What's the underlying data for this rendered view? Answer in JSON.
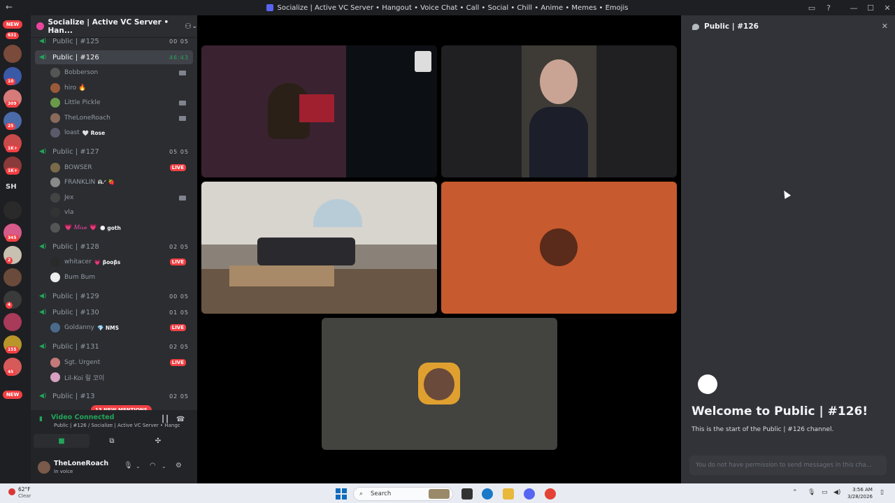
{
  "window": {
    "title": "Socialize | Active VC Server • Hangout • Voice Chat • Call • Social • Chill • Anime • Memes • Emojis"
  },
  "rail": {
    "new_label": "NEW",
    "badges": [
      "631",
      "10",
      "309",
      "25",
      "1K+",
      "1K+",
      "345",
      "2",
      "4",
      "155",
      "45"
    ],
    "sh_label": "SH"
  },
  "guild": {
    "name": "Socialize | Active VC Server • Han..."
  },
  "channels": [
    {
      "name": "Public | #125",
      "count": "00 05"
    },
    {
      "name": "Public | #126",
      "count": "46:43"
    },
    {
      "name": "Public | #127",
      "count": "05 05"
    },
    {
      "name": "Public | #128",
      "count": "02 05"
    },
    {
      "name": "Public | #129",
      "count": "00 05"
    },
    {
      "name": "Public | #130",
      "count": "01 05"
    },
    {
      "name": "Public | #131",
      "count": "02 05"
    },
    {
      "name": "Public | #13",
      "count": "02 05"
    }
  ],
  "members_126": [
    "Bobberson",
    "hiro 🔥",
    "Little Pickle",
    "TheLoneRoach",
    "loast"
  ],
  "member_126_tag": "🤍 Rose",
  "members_127": [
    "BOWSER",
    "FRANKLIN",
    "Jex",
    "vla",
    "💗 𝑀𝒾𝓈𝒶 💗"
  ],
  "member_127_tag": "🌑 goth",
  "member_127_franklin_tag": "ᕱ.ᐟ 🍓",
  "members_128": [
    "whitacer",
    "Bum Bum"
  ],
  "member_128_tag": "💗 βᴏᴏβs",
  "members_130": [
    "Goldanny"
  ],
  "member_130_tag": "💎 NMS",
  "members_131": [
    "Sgt. Urgent",
    "Lil-Koi 릴 코이"
  ],
  "live_label": "LIVE",
  "mentions_label": "13 NEW MENTIONS",
  "voice": {
    "status": "Video Connected",
    "subtitle": "Public | #126 / Socialize | Active VC Server • Hango..."
  },
  "user": {
    "name": "TheLoneRoach",
    "status": "In voice"
  },
  "chat": {
    "channel": "Public | #126",
    "welcome": "Welcome to Public | #126!",
    "start": "This is the start of the Public | #126 channel.",
    "input_placeholder": "You do not have permission to send messages in this cha..."
  },
  "taskbar": {
    "temp": "62°F",
    "condition": "Clear",
    "search": "Search",
    "time": "3:56 AM",
    "date": "3/28/2026"
  },
  "colors": {
    "accent_green": "#23a559",
    "live_red": "#f23f43",
    "orange_tile": "#c75a2e"
  }
}
